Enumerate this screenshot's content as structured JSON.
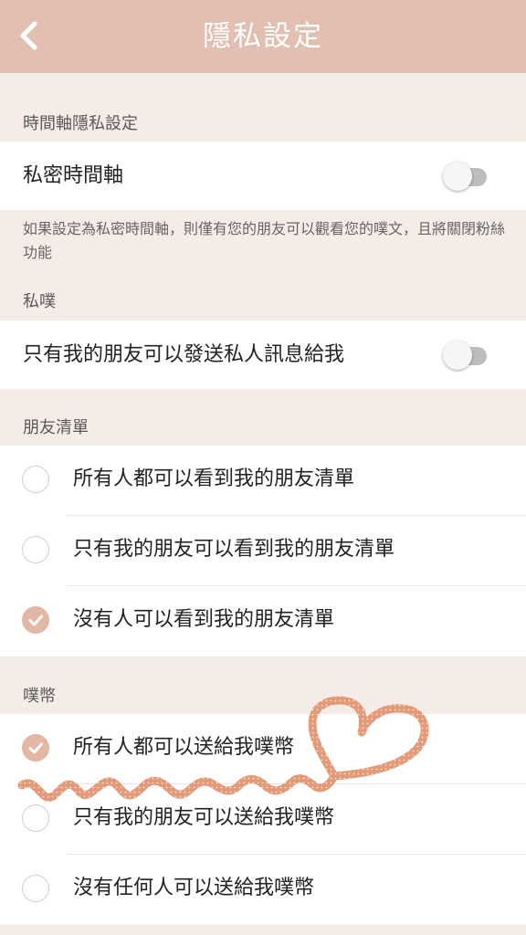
{
  "header": {
    "title": "隱私設定",
    "back_icon": "chevron-left-icon"
  },
  "timeline": {
    "section_label": "時間軸隱私設定",
    "private_label": "私密時間軸",
    "private_on": false,
    "note": "如果設定為私密時間軸，則僅有您的朋友可以觀看您的噗文，且將關閉粉絲功能"
  },
  "private_plurk": {
    "section_label": "私噗",
    "friends_only_label": "只有我的朋友可以發送私人訊息給我",
    "friends_only_on": false
  },
  "friend_list": {
    "section_label": "朋友清單",
    "options": [
      {
        "label": "所有人都可以看到我的朋友清單",
        "selected": false
      },
      {
        "label": "只有我的朋友可以看到我的朋友清單",
        "selected": false
      },
      {
        "label": "沒有人可以看到我的朋友清單",
        "selected": true
      }
    ]
  },
  "coins": {
    "section_label": "噗幣",
    "options": [
      {
        "label": "所有人都可以送給我噗幣",
        "selected": true
      },
      {
        "label": "只有我的朋友可以送給我噗幣",
        "selected": false
      },
      {
        "label": "沒有任何人可以送給我噗幣",
        "selected": false
      }
    ]
  },
  "colors": {
    "header_bg": "#e2bfb0",
    "accent": "#e3b7a4",
    "page_bg": "#f5ebe7",
    "scribble": "#e39a78"
  }
}
